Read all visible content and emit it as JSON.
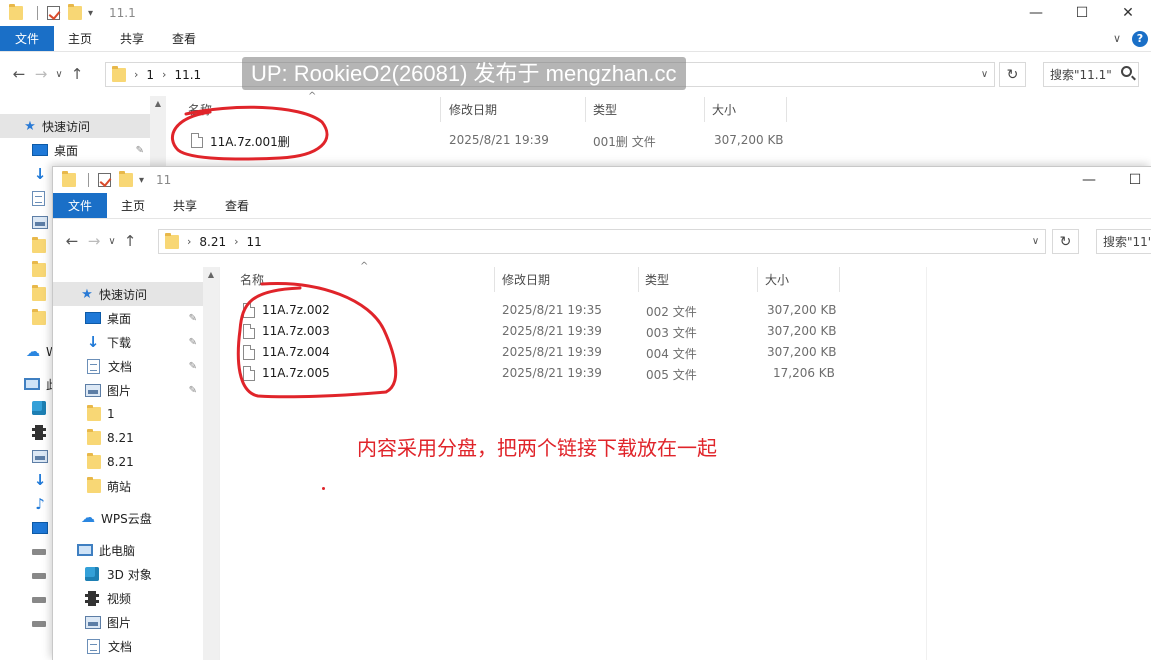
{
  "watermark": "UP: RookieO2(26081) 发布于 mengzhan.cc",
  "annotation": "内容采用分盘，把两个链接下载放在一起",
  "colors": {
    "accent": "#1a6fc7",
    "ink": "#e0242a"
  },
  "back_window": {
    "title": "11.1",
    "ribbon": {
      "file": "文件",
      "home": "主页",
      "share": "共享",
      "view": "查看"
    },
    "address": [
      "1",
      "11.1"
    ],
    "search_placeholder": "搜索\"11.1\"",
    "columns": {
      "name": "名称",
      "date": "修改日期",
      "type": "类型",
      "size": "大小"
    },
    "rows": [
      {
        "name": "11A.7z.001删",
        "date": "2025/8/21 19:39",
        "type": "001删 文件",
        "size": "307,200 KB"
      }
    ],
    "sidebar": {
      "quick_access": "快速访问",
      "desktop": "桌面",
      "wps_partial": "W",
      "pc_partial": "此"
    }
  },
  "front_window": {
    "title": "11",
    "ribbon": {
      "file": "文件",
      "home": "主页",
      "share": "共享",
      "view": "查看"
    },
    "address": [
      "8.21",
      "11"
    ],
    "search_placeholder": "搜索\"11\"",
    "columns": {
      "name": "名称",
      "date": "修改日期",
      "type": "类型",
      "size": "大小"
    },
    "rows": [
      {
        "name": "11A.7z.002",
        "date": "2025/8/21 19:35",
        "type": "002 文件",
        "size": "307,200 KB"
      },
      {
        "name": "11A.7z.003",
        "date": "2025/8/21 19:39",
        "type": "003 文件",
        "size": "307,200 KB"
      },
      {
        "name": "11A.7z.004",
        "date": "2025/8/21 19:39",
        "type": "004 文件",
        "size": "307,200 KB"
      },
      {
        "name": "11A.7z.005",
        "date": "2025/8/21 19:39",
        "type": "005 文件",
        "size": "17,206 KB"
      }
    ],
    "sidebar": {
      "quick_access": "快速访问",
      "desktop": "桌面",
      "downloads": "下载",
      "documents": "文档",
      "pictures": "图片",
      "folder_1": "1",
      "folder_821a": "8.21",
      "folder_821b": "8.21",
      "folder_mengzhan": "萌站",
      "wps": "WPS云盘",
      "this_pc": "此电脑",
      "objects3d": "3D 对象",
      "videos": "视频",
      "pictures2": "图片",
      "documents2": "文档"
    }
  },
  "icons": {
    "window_minimize": "—",
    "window_maximize": "☐",
    "window_close": "✕",
    "nav_back": "←",
    "nav_forward": "→",
    "nav_up": "↑",
    "refresh": "↻",
    "pin": "📌"
  }
}
